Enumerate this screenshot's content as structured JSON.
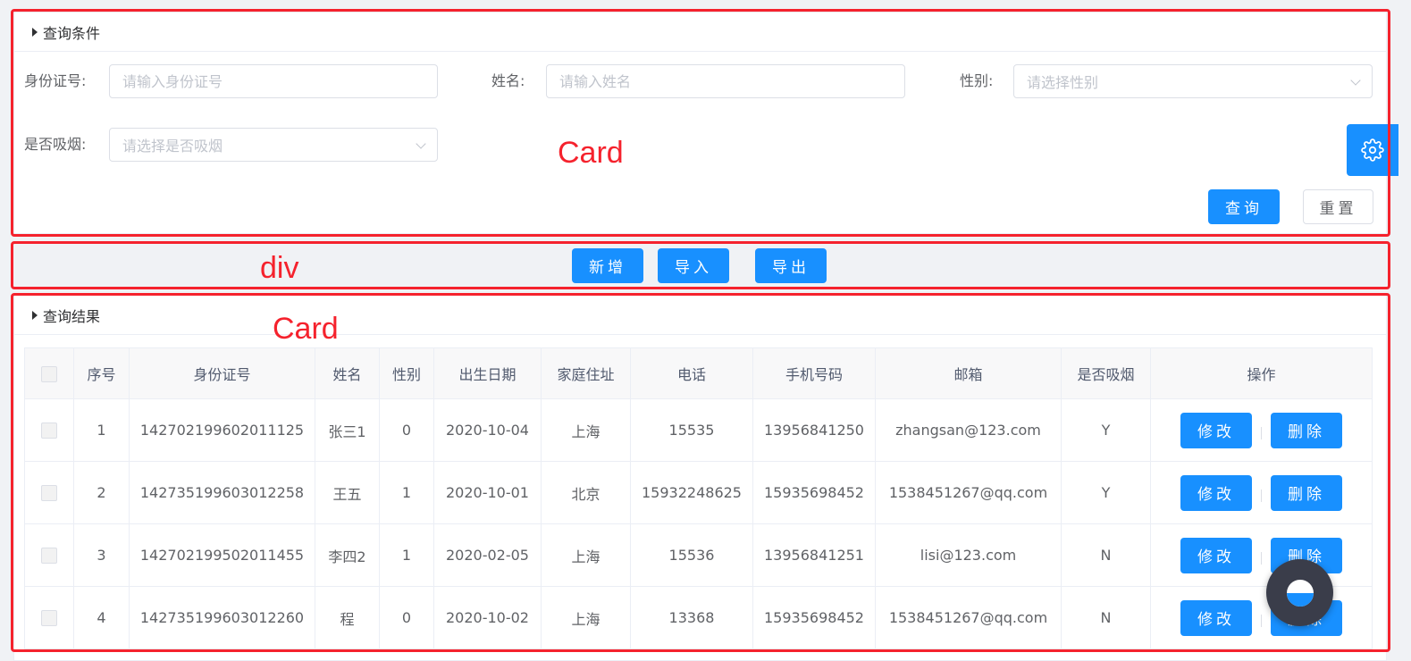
{
  "query_card": {
    "header": "查询条件",
    "fields": {
      "id_label": "身份证号:",
      "id_placeholder": "请输入身份证号",
      "name_label": "姓名:",
      "name_placeholder": "请输入姓名",
      "gender_label": "性别:",
      "gender_placeholder": "请选择性别",
      "smoke_label": "是否吸烟:",
      "smoke_placeholder": "请选择是否吸烟"
    },
    "search_btn": "查询",
    "reset_btn": "重置"
  },
  "toolbar": {
    "add_btn": "新增",
    "import_btn": "导入",
    "export_btn": "导出"
  },
  "result_card": {
    "header": "查询结果",
    "columns": [
      "序号",
      "身份证号",
      "姓名",
      "性别",
      "出生日期",
      "家庭住址",
      "电话",
      "手机号码",
      "邮箱",
      "是否吸烟",
      "操作"
    ],
    "rows": [
      {
        "no": "1",
        "id": "142702199602011125",
        "name": "张三1",
        "gender": "0",
        "birth": "2020-10-04",
        "addr": "上海",
        "tel": "15535",
        "mobile": "13956841250",
        "email": "zhangsan@123.com",
        "smoke": "Y"
      },
      {
        "no": "2",
        "id": "142735199603012258",
        "name": "王五",
        "gender": "1",
        "birth": "2020-10-01",
        "addr": "北京",
        "tel": "15932248625",
        "mobile": "15935698452",
        "email": "1538451267@qq.com",
        "smoke": "Y"
      },
      {
        "no": "3",
        "id": "142702199502011455",
        "name": "李四2",
        "gender": "1",
        "birth": "2020-02-05",
        "addr": "上海",
        "tel": "15536",
        "mobile": "13956841251",
        "email": "lisi@123.com",
        "smoke": "N"
      },
      {
        "no": "4",
        "id": "142735199603012260",
        "name": "程",
        "gender": "0",
        "birth": "2020-10-02",
        "addr": "上海",
        "tel": "13368",
        "mobile": "15935698452",
        "email": "1538451267@qq.com",
        "smoke": "N"
      }
    ],
    "edit_btn": "修改",
    "delete_btn": "删除"
  },
  "annotations": {
    "card1": "Card",
    "div": "div",
    "card2": "Card"
  },
  "colors": {
    "primary": "#1890ff",
    "annotation": "#f5222d"
  }
}
